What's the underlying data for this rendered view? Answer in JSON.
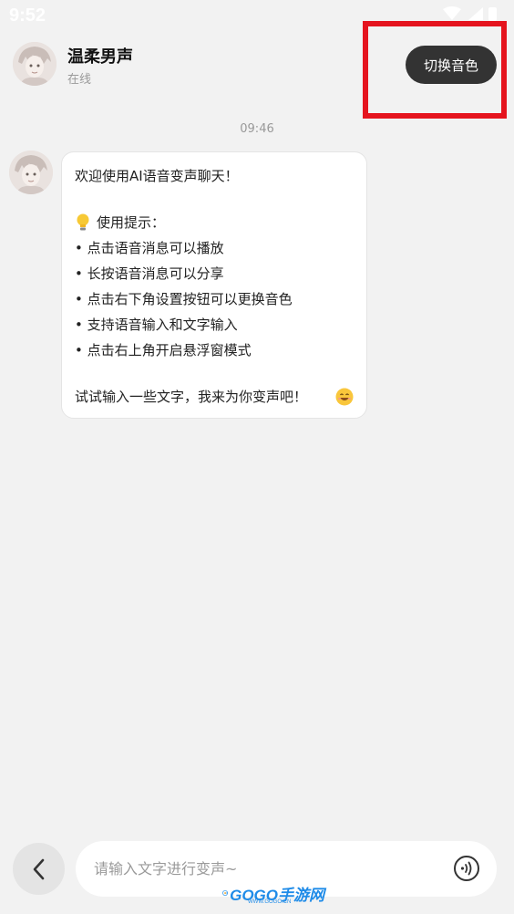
{
  "status_bar": {
    "time": "9:52",
    "icons": [
      "wifi-icon",
      "signal-icon",
      "battery-icon"
    ]
  },
  "header": {
    "contact_name": "温柔男声",
    "contact_status": "在线",
    "switch_voice_label": "切换音色"
  },
  "chat": {
    "timestamp": "09:46",
    "message": {
      "greeting": "欢迎使用AI语音变声聊天！",
      "tips_title": "使用提示：",
      "tips": [
        "• 点击语音消息可以播放",
        "• 长按语音消息可以分享",
        "• 点击右下角设置按钮可以更换音色",
        "• 支持语音输入和文字输入",
        "• 点击右上角开启悬浮窗模式"
      ],
      "closing": "试试输入一些文字，我来为你变声吧！"
    }
  },
  "input": {
    "placeholder": "请输入文字进行变声~",
    "value": ""
  },
  "watermark": {
    "text": "GOGO手游网",
    "subtext": "WWW.GOGO.CN"
  },
  "colors": {
    "background": "#f2f2f2",
    "button_dark": "#333333",
    "highlight_red": "#e5141e",
    "watermark_blue": "#1e8be8"
  }
}
